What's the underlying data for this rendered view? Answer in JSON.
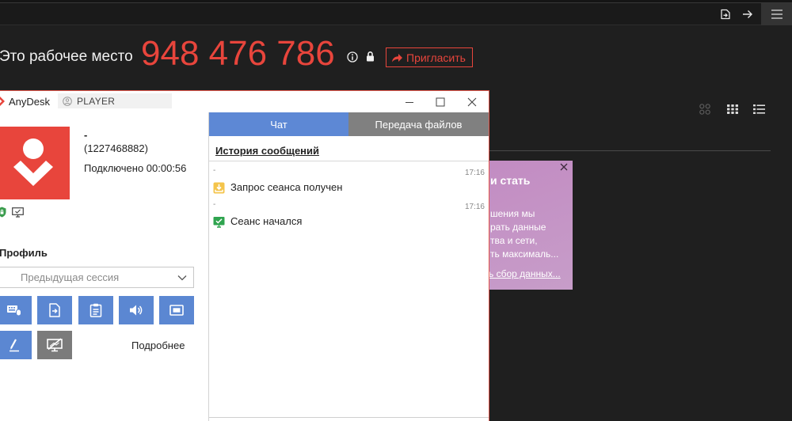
{
  "toolbar": {
    "icons": [
      "file-transfer-icon",
      "arrow-right-icon",
      "menu-icon"
    ]
  },
  "workplace": {
    "label": "Это рабочее место",
    "address": "948 476 786",
    "invite_label": "Пригласить"
  },
  "view_options": [
    "tiles-icon",
    "grid-icon",
    "list-icon"
  ],
  "notification": {
    "title": "и стать",
    "lines": [
      "шения мы",
      "рать данные",
      "тва и сети,",
      "ть максималь..."
    ],
    "link": "ь сбор данных..."
  },
  "session": {
    "app_name": "AnyDesk",
    "search_value": "PLAYER",
    "remote": {
      "name": "-",
      "id": "(1227468882)",
      "status": "Подключено 00:00:56"
    },
    "profile": {
      "label": "Профиль",
      "selected": "Предыдущая сессия"
    },
    "actions": [
      "input-control-icon",
      "file-transfer-icon",
      "clipboard-icon",
      "audio-icon",
      "display-icon",
      "whiteboard-pen-icon",
      "privacy-mode-icon"
    ],
    "more_label": "Подробнее",
    "tabs": [
      {
        "label": "Чат",
        "active": true
      },
      {
        "label": "Передача файлов",
        "active": false
      }
    ],
    "chat": {
      "history_label": "История сообщений",
      "messages": [
        {
          "sender": "-",
          "time": "17:16",
          "icon": "session-request-icon",
          "text": "Запрос сеанса получен"
        },
        {
          "sender": "-",
          "time": "17:16",
          "icon": "session-started-icon",
          "text": "Сеанс начался"
        }
      ]
    }
  },
  "colors": {
    "accent": "#e8453c",
    "action_button": "#5b87d2",
    "tab_active": "#5d88d5",
    "tab_inactive": "#808080",
    "notification": "#c48dc3",
    "background": "#1f1f1f"
  }
}
